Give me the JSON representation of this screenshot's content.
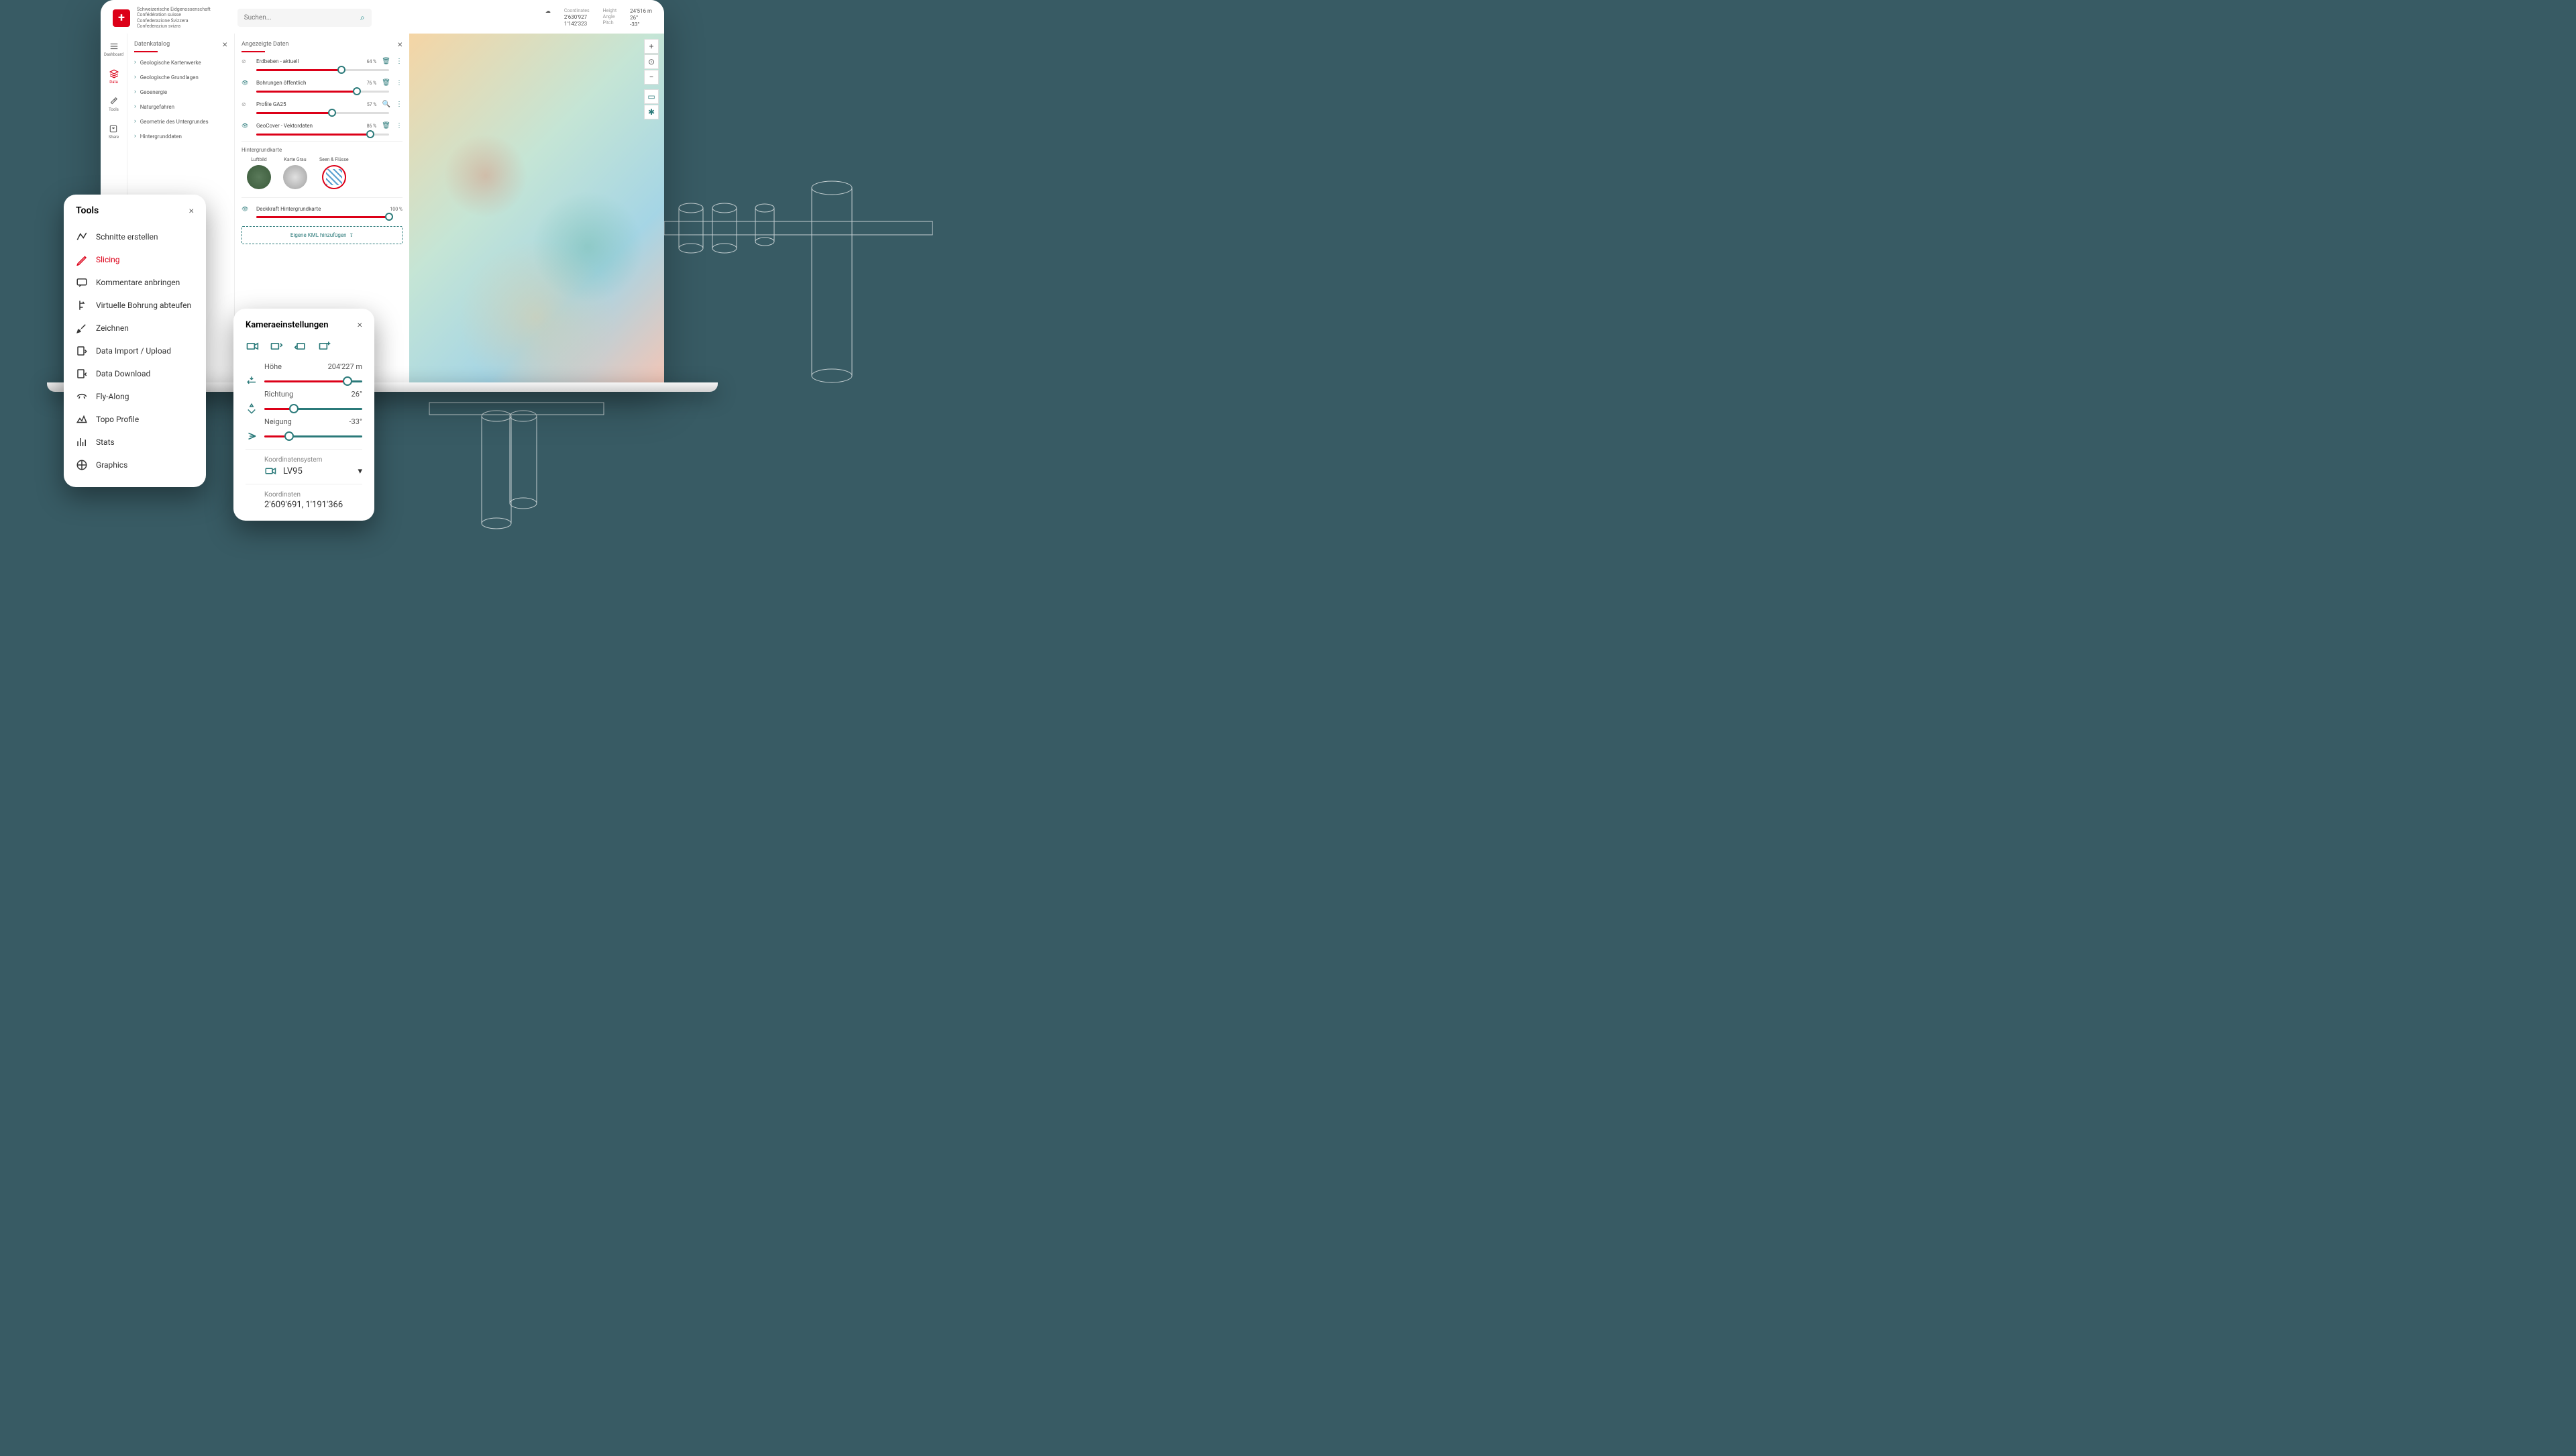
{
  "header": {
    "confederation_lines": [
      "Schweizerische Eidgenossenschaft",
      "Confédération suisse",
      "Confederazione Svizzera",
      "Confederaziun svizra"
    ],
    "search_placeholder": "Suchen...",
    "coords": {
      "label_coordinates": "Coordinates",
      "label_height": "Height",
      "x": "2'630'927",
      "y": "1'142'323",
      "height_val": "24'516 m",
      "label_angle": "Angle",
      "angle_val": "26°",
      "label_pitch": "Pitch",
      "pitch_val": "-33°"
    }
  },
  "sidebar": {
    "items": [
      {
        "label": "Dashboard"
      },
      {
        "label": "Data"
      },
      {
        "label": "Tools"
      },
      {
        "label": "Share"
      }
    ]
  },
  "catalog": {
    "title": "Datenkatalog",
    "items": [
      "Geologische Kartenwerke",
      "Geologische Grundlagen",
      "Geoenergie",
      "Naturgefahren",
      "Geometrie des Untergrundes",
      "Hintergrunddaten"
    ]
  },
  "displayed": {
    "title": "Angezeigte Daten",
    "layers": [
      {
        "name": "Erdbeben - aktuell",
        "pct": "64 %",
        "val": 64,
        "visible": false
      },
      {
        "name": "Bohrungen öffentlich",
        "pct": "76 %",
        "val": 76,
        "visible": true
      },
      {
        "name": "Profile GA25",
        "pct": "57 %",
        "val": 57,
        "visible": false
      },
      {
        "name": "GeoCover - Vektordaten",
        "pct": "86 %",
        "val": 86,
        "visible": true
      }
    ],
    "background_title": "Hintergrundkarte",
    "backgrounds": [
      {
        "label": "Luftbild"
      },
      {
        "label": "Karte Grau"
      },
      {
        "label": "Seen & Flüsse"
      }
    ],
    "bg_opacity_label": "Deckkraft Hintergrundkarte",
    "bg_opacity_pct": "100 %",
    "bg_opacity_val": 100,
    "kml_label": "Eigene KML hinzufügen"
  },
  "tools": {
    "title": "Tools",
    "items": [
      {
        "label": "Schnitte erstellen"
      },
      {
        "label": "Slicing",
        "active": true
      },
      {
        "label": "Kommentare anbringen"
      },
      {
        "label": "Virtuelle Bohrung abteufen"
      },
      {
        "label": "Zeichnen"
      },
      {
        "label": "Data Import / Upload"
      },
      {
        "label": "Data Download"
      },
      {
        "label": "Fly-Along"
      },
      {
        "label": "Topo Profile"
      },
      {
        "label": "Stats"
      },
      {
        "label": "Graphics"
      }
    ]
  },
  "camera": {
    "title": "Kameraeinstellungen",
    "rows": [
      {
        "label": "Höhe",
        "value": "204'227 m",
        "pos": 85
      },
      {
        "label": "Richtung",
        "value": "26°",
        "pos": 30
      },
      {
        "label": "Neigung",
        "value": "-33°",
        "pos": 25
      }
    ],
    "coord_system_label": "Koordinatensystem",
    "coord_system_value": "LV95",
    "coords_label": "Koordinaten",
    "coords_value": "2'609'691, 1'191'366"
  }
}
